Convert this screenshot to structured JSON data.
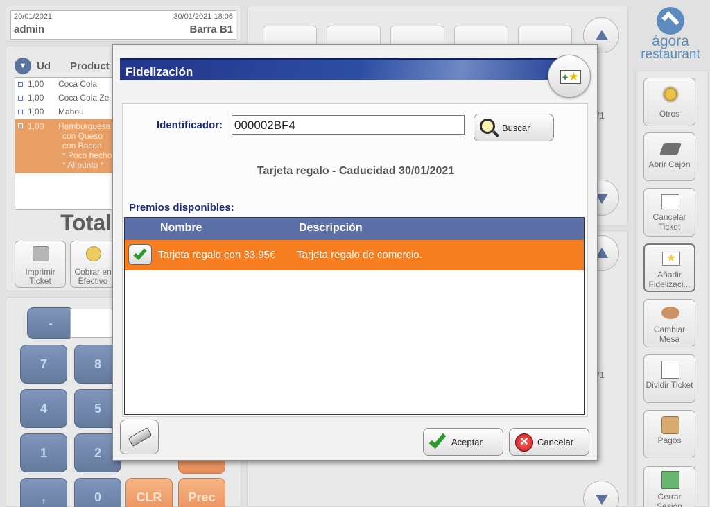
{
  "ticket": {
    "date": "20/01/2021",
    "datetime": "30/01/2021 18:06",
    "user": "admin",
    "location": "Barra B1",
    "col_ud": "Ud",
    "col_product": "Product",
    "lines": [
      {
        "qty": "1,00",
        "name": "Coca Cola"
      },
      {
        "qty": "1,00",
        "name": "Coca Cola Ze"
      },
      {
        "qty": "1,00",
        "name": "Mahou"
      }
    ],
    "selected_line": {
      "qty": "1,00",
      "name": "Hamburguesa",
      "modifiers": [
        "con Queso",
        "con Bacon",
        "* Poco hecho",
        "* Al punto *"
      ]
    },
    "total_label": "Total",
    "print_label": "Imprimir\nTicket",
    "charge_label": "Cobrar en\nEfectivo"
  },
  "keypad": {
    "minus": "-",
    "keys_row1": [
      "7",
      "8"
    ],
    "keys_row2": [
      "4",
      "5"
    ],
    "keys_row3": [
      "1",
      "2"
    ],
    "keys_row4": [
      ",",
      "0"
    ],
    "clr": "CLR",
    "prec": "Prec"
  },
  "products": {
    "page_top": "/1",
    "page_bottom": "/1"
  },
  "brand": {
    "name_top": "ágora",
    "name_bottom": "restaurant",
    "accent": "#1f5fa6"
  },
  "side_actions": [
    {
      "label": "Otros",
      "icon": "gears-icon"
    },
    {
      "label": "Abrir Cajón",
      "icon": "cash-drawer-icon"
    },
    {
      "label": "Cancelar Ticket",
      "icon": "cancel-ticket-icon"
    },
    {
      "label": "Añadir Fidelizaci...",
      "icon": "loyalty-star-icon"
    },
    {
      "label": "Cambiar Mesa",
      "icon": "table-icon"
    },
    {
      "label": "Dividir Ticket",
      "icon": "split-ticket-icon"
    },
    {
      "label": "Pagos",
      "icon": "payments-icon"
    },
    {
      "label": "Cerrar Sesión",
      "icon": "logout-icon"
    }
  ],
  "dialog": {
    "title": "Fidelización",
    "id_label": "Identificador:",
    "id_value": "000002BF4",
    "search_label": "Buscar",
    "card_info": "Tarjeta regalo - Caducidad 30/01/2021",
    "rewards_label": "Premios disponibles:",
    "columns": [
      "Nombre",
      "Descripción"
    ],
    "rows": [
      {
        "name": "Tarjeta regalo con 33.95€",
        "description": "Tarjeta regalo de comercio.",
        "checked": true
      }
    ],
    "accept_label": "Aceptar",
    "cancel_label": "Cancelar",
    "row_color": "#f67e20",
    "header_color": "#5c6fa6"
  }
}
